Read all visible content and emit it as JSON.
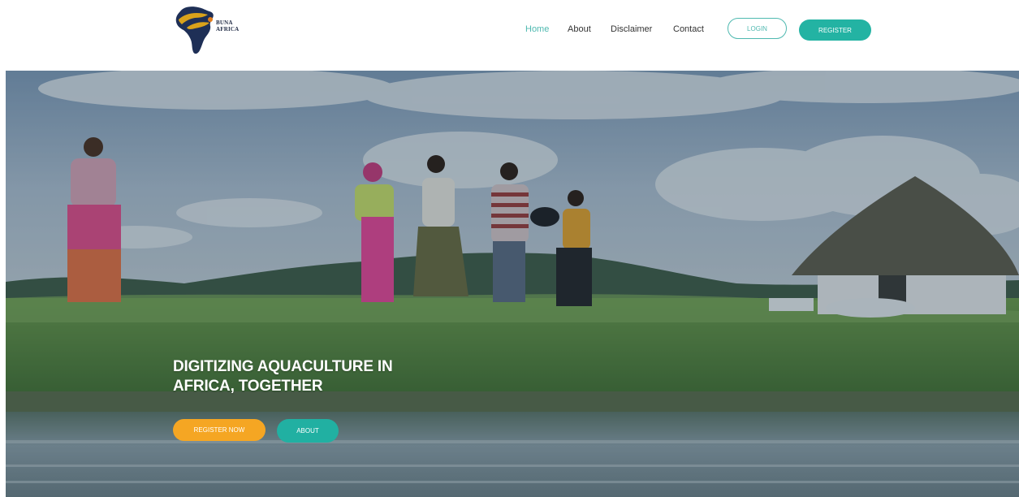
{
  "brand": {
    "logo_text_line1": "BUNA",
    "logo_text_line2": "AFRICA",
    "colors": {
      "map_dark": "#1e2f56",
      "map_gold": "#d9a21b"
    }
  },
  "nav": {
    "items": [
      {
        "label": "Home",
        "active": true
      },
      {
        "label": "About",
        "active": false
      },
      {
        "label": "Disclaimer",
        "active": false
      },
      {
        "label": "Contact",
        "active": false
      }
    ],
    "login_label": "LOGIN",
    "register_label": "REGISTER"
  },
  "hero": {
    "title_line1": "DIGITIZING AQUACULTURE IN",
    "title_line2": "AFRICA, TOGETHER",
    "register_now_label": "REGISTER NOW",
    "about_label": "ABOUT"
  },
  "colors": {
    "accent_teal": "#23b3a3",
    "accent_orange": "#f5a623",
    "active_nav": "#4fb9b0"
  }
}
